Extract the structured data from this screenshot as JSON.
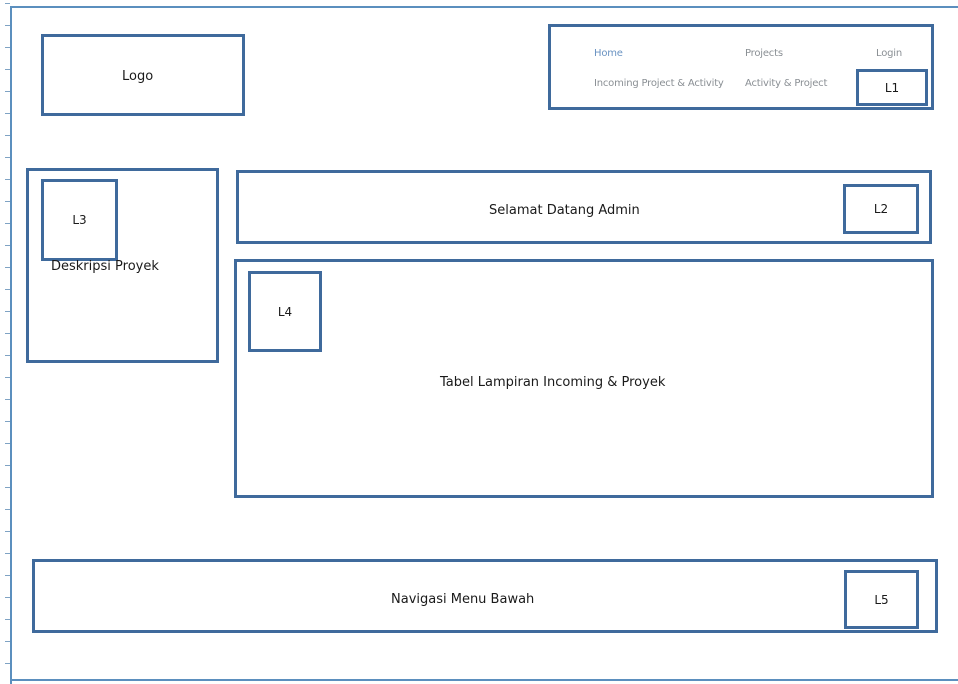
{
  "logo": {
    "label": "Logo"
  },
  "nav": {
    "home": "Home",
    "projects": "Projects",
    "login": "Login",
    "incoming": "Incoming Project & Activity",
    "activity": "Activity & Project",
    "tag": "L1"
  },
  "welcome": {
    "text": "Selamat Datang  Admin",
    "tag": "L2"
  },
  "description": {
    "text": "Deskripsi Proyek",
    "tag": "L3"
  },
  "table": {
    "text": "Tabel Lampiran  Incoming  & Proyek",
    "tag": "L4"
  },
  "footer": {
    "text": "Navigasi Menu  Bawah",
    "tag": "L5"
  }
}
